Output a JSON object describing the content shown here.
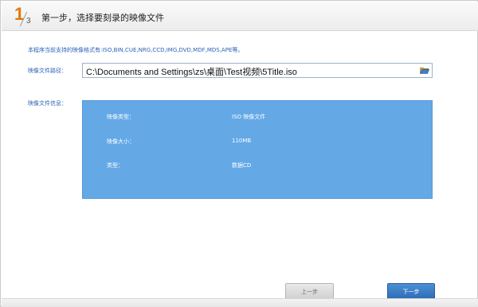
{
  "header": {
    "step_current": "1",
    "step_total": "3",
    "title": "第一步，选择要刻录的映像文件"
  },
  "support_note": "本程序当前支持的映像格式有:ISO,BIN,CUE,NRG,CCD,IMG,DVD,MDF,MDS,APE等。",
  "path": {
    "label": "映像文件路径：",
    "value": "C:\\Documents and Settings\\zs\\桌面\\Test视频\\5Title.iso",
    "icon": "folder-open-icon"
  },
  "info": {
    "label": "映像文件信息：",
    "rows": [
      {
        "key": "映像类型：",
        "value": "ISO 映像文件"
      },
      {
        "key": "映像大小：",
        "value": "110MB"
      },
      {
        "key": "类型：",
        "value": "数据CD"
      }
    ],
    "panel_color": "#64a8e6"
  },
  "buttons": {
    "prev": "上一步",
    "next": "下一步"
  },
  "colors": {
    "accent": "#e07a00",
    "label_blue": "#2a62b8",
    "next_button": "#2a6bb4"
  }
}
